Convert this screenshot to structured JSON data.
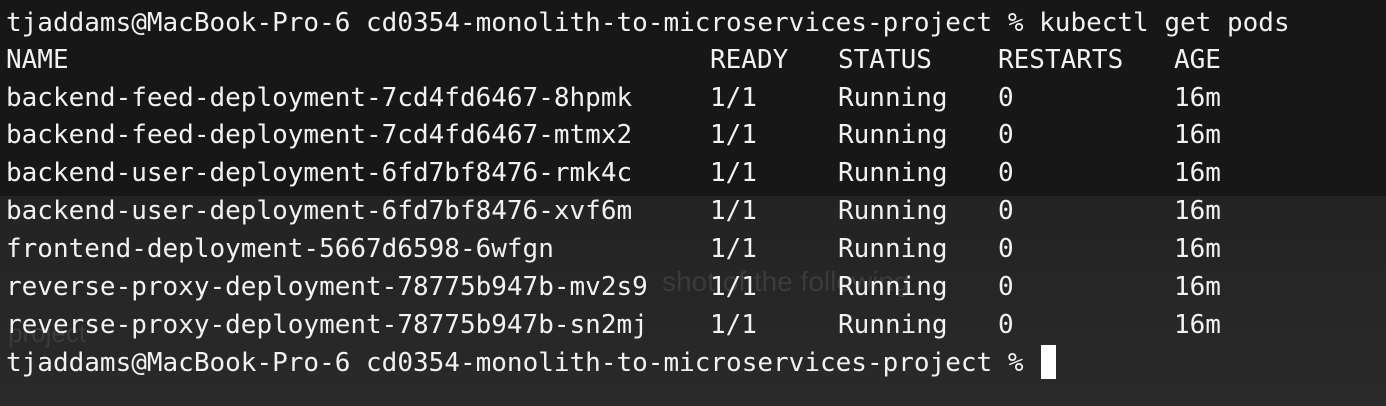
{
  "terminal": {
    "prompt_user_host": "tjaddams@MacBook-Pro-6",
    "prompt_dir": "cd0354-monolith-to-microservices-project",
    "prompt_symbol": "%",
    "command": "kubectl get pods",
    "headers": {
      "name": "NAME",
      "ready": "READY",
      "status": "STATUS",
      "restarts": "RESTARTS",
      "age": "AGE"
    },
    "pods": [
      {
        "name": "backend-feed-deployment-7cd4fd6467-8hpmk",
        "ready": "1/1",
        "status": "Running",
        "restarts": "0",
        "age": "16m"
      },
      {
        "name": "backend-feed-deployment-7cd4fd6467-mtmx2",
        "ready": "1/1",
        "status": "Running",
        "restarts": "0",
        "age": "16m"
      },
      {
        "name": "backend-user-deployment-6fd7bf8476-rmk4c",
        "ready": "1/1",
        "status": "Running",
        "restarts": "0",
        "age": "16m"
      },
      {
        "name": "backend-user-deployment-6fd7bf8476-xvf6m",
        "ready": "1/1",
        "status": "Running",
        "restarts": "0",
        "age": "16m"
      },
      {
        "name": "frontend-deployment-5667d6598-6wfgn",
        "ready": "1/1",
        "status": "Running",
        "restarts": "0",
        "age": "16m"
      },
      {
        "name": "reverse-proxy-deployment-78775b947b-mv2s9",
        "ready": "1/1",
        "status": "Running",
        "restarts": "0",
        "age": "16m"
      },
      {
        "name": "reverse-proxy-deployment-78775b947b-sn2mj",
        "ready": "1/1",
        "status": "Running",
        "restarts": "0",
        "age": "16m"
      }
    ],
    "background_text": {
      "line1": "shot of the following",
      "line2": "project"
    }
  }
}
